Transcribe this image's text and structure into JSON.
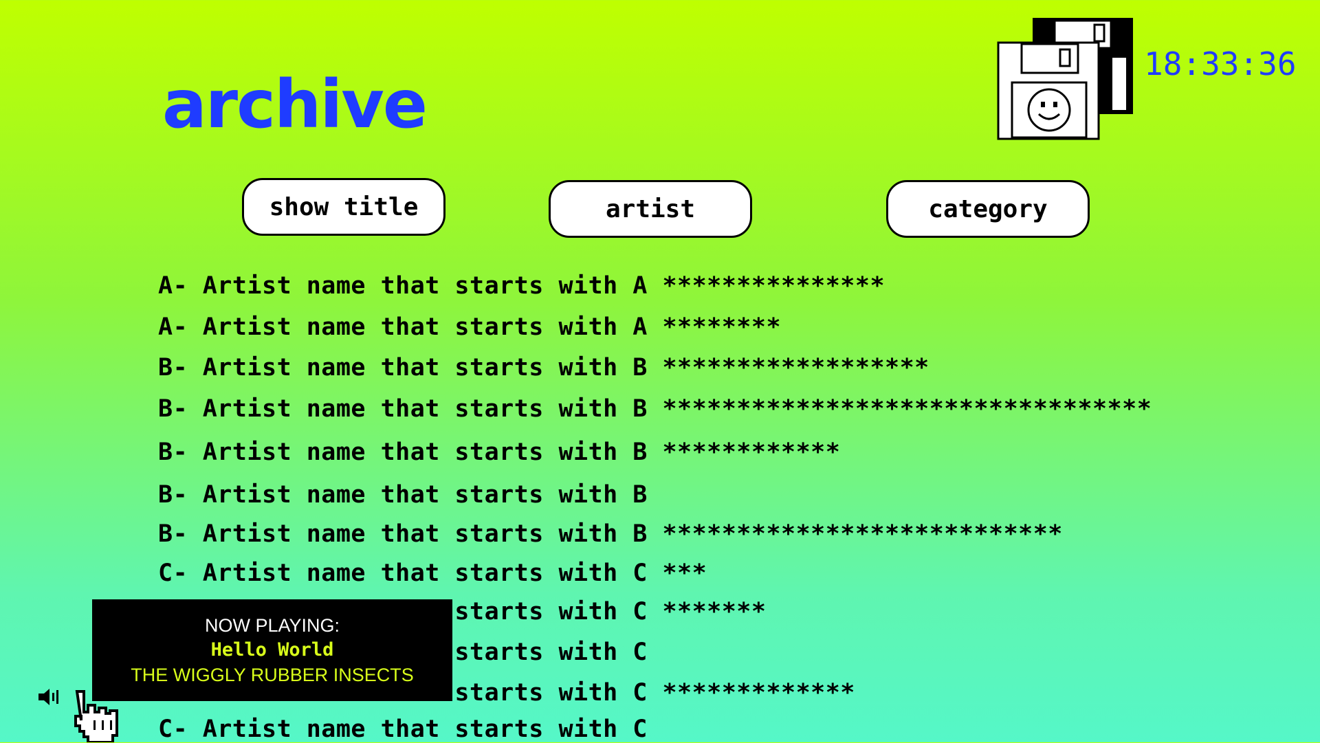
{
  "header": {
    "title": "archive",
    "clock": "18:33:36"
  },
  "tabs": [
    {
      "label": "show title"
    },
    {
      "label": "artist"
    },
    {
      "label": "category"
    }
  ],
  "list": [
    {
      "text": "A- Artist name that starts with A ***************"
    },
    {
      "text": "A- Artist name that starts with A ********"
    },
    {
      "text": "B- Artist name that starts with B ******************"
    },
    {
      "text": "B- Artist name that starts with B *********************************"
    },
    {
      "text": "B- Artist name that starts with B ************"
    },
    {
      "text": "B- Artist name that starts with B"
    },
    {
      "text": "B- Artist name that starts with B ***************************"
    },
    {
      "text": "C- Artist name that starts with C ***"
    },
    {
      "text": "C- Artist name that starts with C *******"
    },
    {
      "text": "C- Artist name that starts with C"
    },
    {
      "text": "C- Artist name that starts with C *************"
    },
    {
      "text": "C- Artist name that starts with C"
    }
  ],
  "now_playing": {
    "label": "NOW PLAYING:",
    "song": "Hello World",
    "artist": "THE WIGGLY RUBBER INSECTS"
  },
  "icons": {
    "floppy": "floppy-disk-smiley-icon",
    "volume": "speaker-volume-icon",
    "cursor": "hand-pointer-icon"
  },
  "colors": {
    "accent": "#1f3cff",
    "now_playing_text": "#d9ff1a",
    "background_top": "#bfff00",
    "background_bottom": "#55f7c8"
  }
}
